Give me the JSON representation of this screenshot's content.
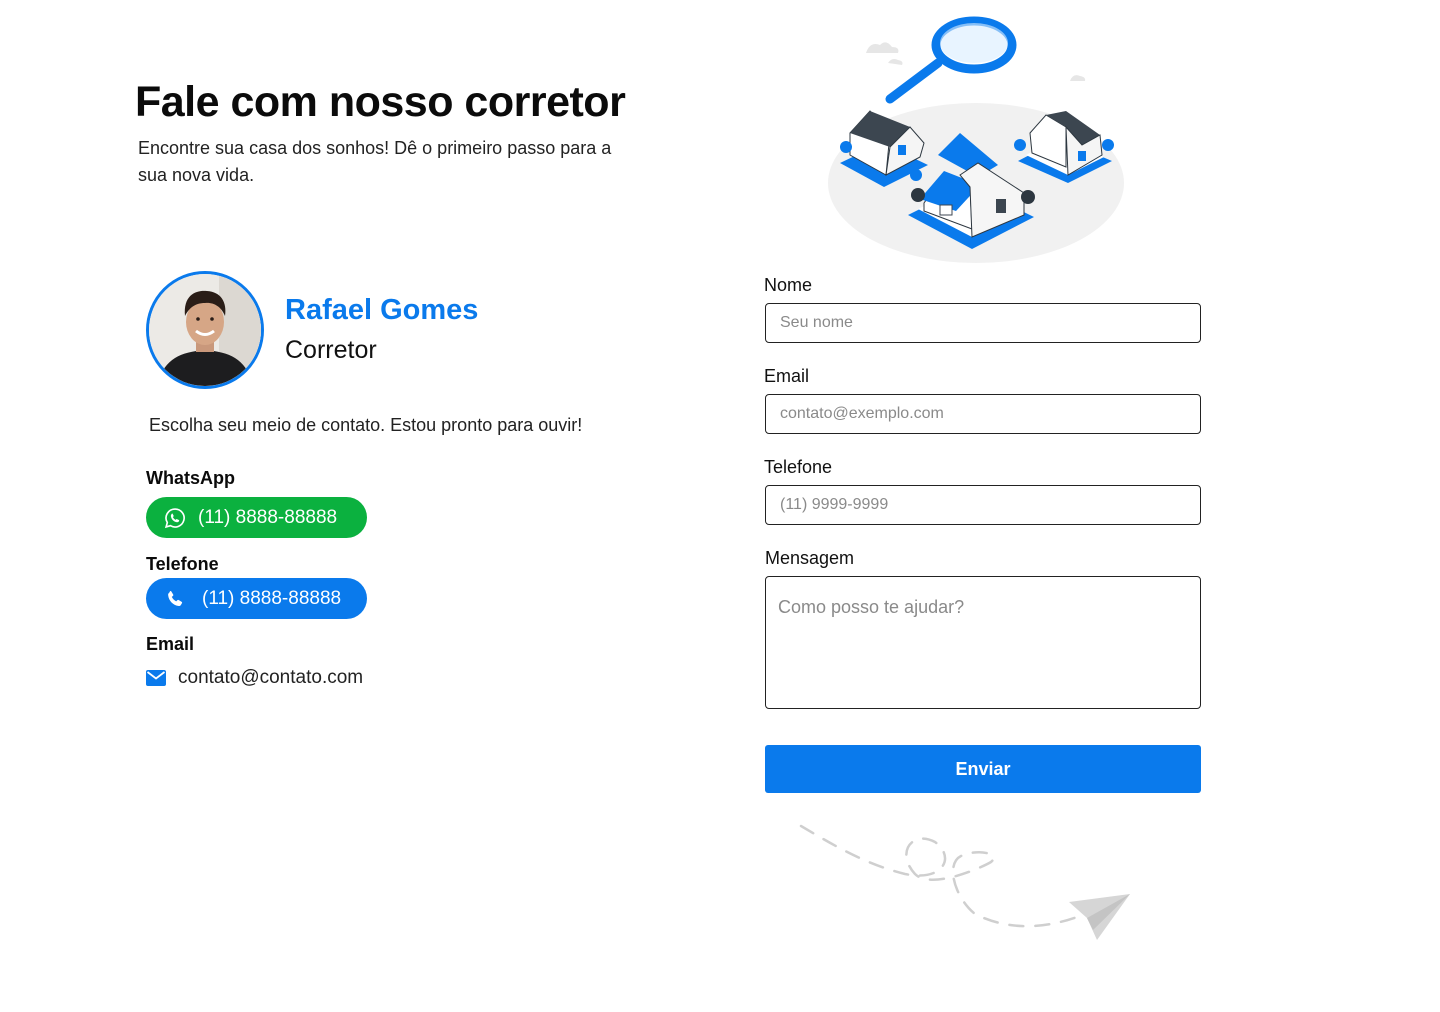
{
  "header": {
    "title": "Fale com nosso corretor",
    "subtitle": "Encontre sua casa dos sonhos! Dê o primeiro passo para a sua nova vida."
  },
  "agent": {
    "name": "Rafael Gomes",
    "role": "Corretor",
    "avatar_icon": "person-photo"
  },
  "contact": {
    "intro": "Escolha seu meio de contato. Estou pronto para ouvir!",
    "whatsapp": {
      "label": "WhatsApp",
      "number": "(11) 8888-88888",
      "icon": "whatsapp-icon",
      "color": "#0bb13f"
    },
    "phone": {
      "label": "Telefone",
      "number": "(11) 8888-88888",
      "icon": "phone-icon",
      "color": "#0a7aec"
    },
    "email": {
      "label": "Email",
      "address": "contato@contato.com",
      "icon": "envelope-icon"
    }
  },
  "form": {
    "name": {
      "label": "Nome",
      "placeholder": "Seu nome"
    },
    "email": {
      "label": "Email",
      "placeholder": "contato@exemplo.com"
    },
    "phone": {
      "label": "Telefone",
      "placeholder": "(11) 9999-9999"
    },
    "message": {
      "label": "Mensagem",
      "placeholder": "Como posso te ajudar?"
    },
    "submit_label": "Enviar"
  },
  "colors": {
    "accent": "#0a7aec",
    "whatsapp": "#0bb13f"
  }
}
